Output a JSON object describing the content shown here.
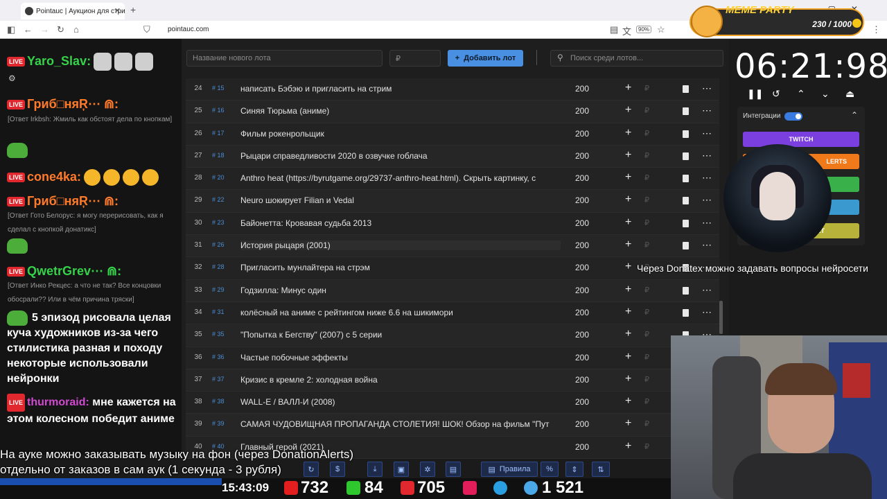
{
  "browser": {
    "tab_title": "Pointauc | Аукцион для стрим",
    "url": "pointauc.com",
    "zoom": "90%"
  },
  "overlay": {
    "meme_title": "MEME PARTY",
    "meme_count": "230 / 1000"
  },
  "chat": {
    "messages": [
      {
        "user": "Yaro_Slav:",
        "color": "#35d24a"
      },
      {
        "user": "Гриб□няŖ⋯ ⋒:",
        "color": "#ff7a2a",
        "reply": "[Ответ Irkbsh: Жмиль как обстоят дела по кнопкам]"
      },
      {
        "user": "cone4ka:",
        "color": "#ff7a2a"
      },
      {
        "user": "Гриб□няŖ⋯ ⋒:",
        "color": "#ff7a2a",
        "reply": "[Ответ Гото Белорус: я могу перерисовать, как я сделал с кнопкой донатикс]"
      },
      {
        "user": "QwetrGrev⋯ ⋒:",
        "color": "#35d24a",
        "reply": "[Ответ Инко Рекцес: а что не так? Все концовки обосрали?? Или в чём причина тряски]"
      }
    ],
    "big_text": "5 эпизод рисовала целая куча художников из-за чего стилистика разная и походу некоторые использовали нейронки",
    "last_user": "thurmoraid:",
    "last_text": "мне кажется на этом колесном победит аниме"
  },
  "toolbar": {
    "lot_name_placeholder": "Название нового лота",
    "amount_placeholder": "₽",
    "add_button": "Добавить лот",
    "search_placeholder": "Поиск среди лотов..."
  },
  "lots": [
    {
      "num": "24",
      "id": "# 15",
      "name": "написать Бэбэю и пригласить на стрим",
      "amount": "200"
    },
    {
      "num": "25",
      "id": "# 16",
      "name": "Синяя Тюрьма (аниме)",
      "amount": "200"
    },
    {
      "num": "26",
      "id": "# 17",
      "name": "Фильм рокенрольщик",
      "amount": "200"
    },
    {
      "num": "27",
      "id": "# 18",
      "name": "Рыцари справедливости 2020 в озвучке гоблача",
      "amount": "200"
    },
    {
      "num": "28",
      "id": "# 20",
      "name": "Anthro heat (https://byrutgame.org/29737-anthro-heat.html). Скрыть картинку, с",
      "amount": "200"
    },
    {
      "num": "29",
      "id": "# 22",
      "name": "Neuro шокирует Filian и Vedal",
      "amount": "200"
    },
    {
      "num": "30",
      "id": "# 23",
      "name": "Байонетта: Кровавая судьба 2013",
      "amount": "200"
    },
    {
      "num": "31",
      "id": "# 26",
      "name": "История рыцаря (2001)",
      "amount": "200"
    },
    {
      "num": "32",
      "id": "# 28",
      "name": "Пригласить мунлайтера на стрэм",
      "amount": "200"
    },
    {
      "num": "33",
      "id": "# 29",
      "name": "Годзилла: Минус один",
      "amount": "200"
    },
    {
      "num": "34",
      "id": "# 31",
      "name": "колёсный на аниме с рейтингом ниже 6.6 на шикимори",
      "amount": "200"
    },
    {
      "num": "35",
      "id": "# 35",
      "name": "\"Попытка к Бегству\" (2007) с 5 серии",
      "amount": "200"
    },
    {
      "num": "36",
      "id": "# 36",
      "name": "Частые побочные эффекты",
      "amount": "200"
    },
    {
      "num": "37",
      "id": "# 37",
      "name": "Кризис в кремле 2: холодная война",
      "amount": "200"
    },
    {
      "num": "38",
      "id": "# 38",
      "name": "WALL-E / ВАЛЛ-И (2008)",
      "amount": "200"
    },
    {
      "num": "39",
      "id": "# 39",
      "name": "САМАЯ ЧУДОВИЩНАЯ ПРОПАГАНДА СТОЛЕТИЯ! ШОК! Обзор на фильм \"Пут",
      "amount": "200"
    },
    {
      "num": "40",
      "id": "# 40",
      "name": "Главный герой (2021)",
      "amount": "200"
    }
  ],
  "timer": {
    "value": "06:21:98"
  },
  "integrations": {
    "label": "Интеграции",
    "twitch": "TWITCH",
    "alerts": "LERTS",
    "third": "ET"
  },
  "tooltip": "Через Donatex можно задавать вопросы нейросети",
  "bottom_toolbar": {
    "rules": "Правила",
    "percent": "%"
  },
  "caption": {
    "line1": "На ауке можно заказывать музыку на фон (через DonationAlerts)",
    "line2": "отдельно от заказов в сам аук (1 секунда - 3 рубля)"
  },
  "status": {
    "time": "15:43:09",
    "youtube": "732",
    "kick": "84",
    "vk": "705",
    "users": "1 521"
  }
}
